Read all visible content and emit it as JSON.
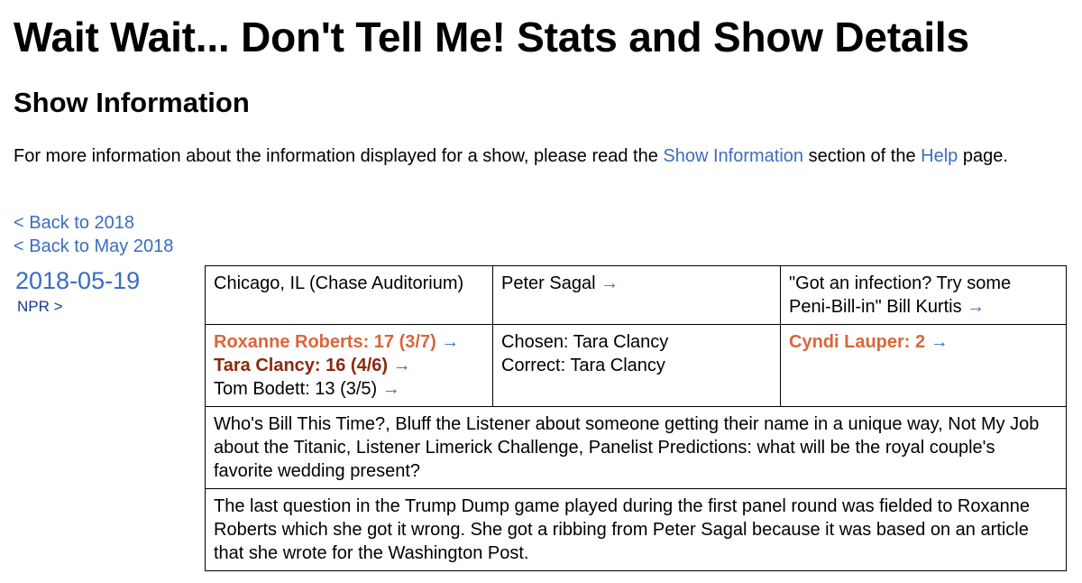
{
  "page": {
    "title": "Wait Wait... Don't Tell Me! Stats and Show Details",
    "section_title": "Show Information",
    "intro": {
      "text_before": "For more information about the information displayed for a show, please read the ",
      "show_info_link": "Show Information",
      "text_middle": " section of the ",
      "help_link": "Help",
      "text_after": " page."
    },
    "back_links": [
      "< Back to 2018",
      "< Back to May 2018"
    ]
  },
  "show": {
    "date": "2018-05-19",
    "npr_link": "NPR >",
    "location": "Chicago, IL (Chase Auditorium)",
    "host": "Peter Sagal",
    "scorekeeper": {
      "quote": "\"Got an infection? Try some Peni-Bill-in\"",
      "name": "Bill Kurtis"
    },
    "panelists": [
      {
        "name_score": "Roxanne Roberts: 17 (3/7)",
        "status": "winner"
      },
      {
        "name_score": "Tara Clancy: 16 (4/6)",
        "status": "second"
      },
      {
        "name_score": "Tom Bodett: 13 (3/5)",
        "status": "normal"
      }
    ],
    "bluff": {
      "chosen": "Chosen: Tara Clancy",
      "correct": "Correct: Tara Clancy"
    },
    "guest": "Cyndi Lauper: 2",
    "arrow": "→",
    "segments": "Who's Bill This Time?, Bluff the Listener about someone getting their name in a unique way, Not My Job about the Titanic, Listener Limerick Challenge, Panelist Predictions: what will be the royal couple's favorite wedding present?",
    "notes": "The last question in the Trump Dump game played during the first panel round was fielded to Roxanne Roberts which she got it wrong. She got a ribbing from Peter Sagal because it was based on an article that she wrote for the Washington Post."
  },
  "colors": {
    "link": "#3a6cc2",
    "winner": "#d9663c",
    "second_place": "#8a2a0e",
    "npr_link": "#1a3a8c"
  }
}
